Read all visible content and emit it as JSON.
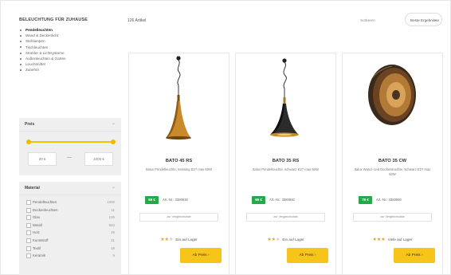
{
  "sidebar": {
    "title": "BELEUCHTUNG FÜR ZUHAUSE",
    "categories": [
      {
        "label": "Pendelleuchten",
        "active": true
      },
      {
        "label": "Wand & Deckenlicht"
      },
      {
        "label": "Stehlampen"
      },
      {
        "label": "Tischleuchten"
      },
      {
        "label": "Strahler & Lichtsysteme"
      },
      {
        "label": "Außenleuchten & Garten"
      },
      {
        "label": "Leuchtmittel"
      },
      {
        "label": "Zubehör"
      }
    ]
  },
  "filters": {
    "price": {
      "title": "Preis",
      "min_value": "30 €",
      "max_value": "1000 €",
      "range_min_fraction": 0.0,
      "range_max_fraction": 1.0
    },
    "material": {
      "title": "Material",
      "options": [
        {
          "label": "Pendelleuchten",
          "count": "1000"
        },
        {
          "label": "Deckenleuchten",
          "count": "11"
        },
        {
          "label": "Glas",
          "count": "125"
        },
        {
          "label": "Metall",
          "count": "844"
        },
        {
          "label": "Holz",
          "count": "29"
        },
        {
          "label": "Kunststoff",
          "count": "31"
        },
        {
          "label": "Textil",
          "count": "18"
        },
        {
          "label": "Keramik",
          "count": "9"
        }
      ]
    }
  },
  "toolbar": {
    "results_label": "126 Artikel",
    "sort_label": "Sortieren",
    "sort_value": "Beste Ergebnisse"
  },
  "products": [
    {
      "name": "BATO 45 RS",
      "description": "Italux Pendelleuchte, messing E27 max 60W",
      "price_badge": "69 €",
      "price_text": "Art.-Nr.: 3380930",
      "shipping": "zur Vergleichsliste",
      "rating": 3,
      "stock": "Ein auf Lager",
      "buy_label": "Ab Preis",
      "colors": {
        "shade": "#c98a2c",
        "shade_dark": "#8f5a16"
      }
    },
    {
      "name": "BATO 35 RS",
      "description": "Italux Pendelleuchte, schwarz E27 max 60W",
      "price_badge": "69 €",
      "price_text": "Art.-Nr.: 3380940",
      "shipping": "zur Vergleichsliste",
      "rating": 3,
      "stock": "Ein auf Lager",
      "buy_label": "Ab Preis",
      "colors": {
        "shade": "#2b2b2b",
        "shade_dark": "#111111"
      }
    },
    {
      "name": "BATO 35 CW",
      "description": "Italux Wand- und Deckenleuchte, schwarz E27 max 60W",
      "price_badge": "79 €",
      "price_text": "Art.-Nr.: 3380950",
      "shipping": "zur Vergleichsliste",
      "rating": 3,
      "stock": "Viele auf Lager",
      "buy_label": "Ab Preis",
      "colors": {
        "shade": "#3a2a1c",
        "shade_dark": "#b27a36"
      }
    }
  ],
  "icon_names": {
    "chevron": "chevron-down-icon",
    "star": "star-icon",
    "cart": "cart-icon"
  }
}
